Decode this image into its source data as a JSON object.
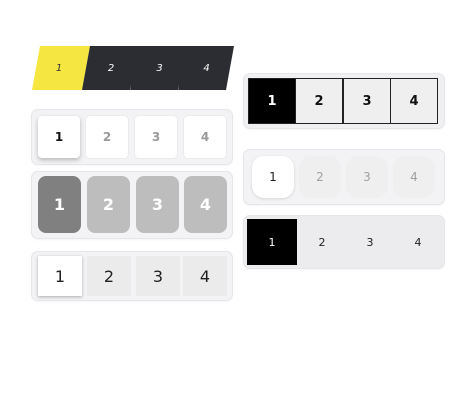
{
  "slanted_tabs": {
    "items": [
      "1",
      "2",
      "3",
      "4"
    ],
    "active_index": 0,
    "active_color": "#f5e642",
    "inactive_color": "#2c2c33"
  },
  "white_cards": {
    "items": [
      "1",
      "2",
      "3",
      "4"
    ],
    "active_index": 0
  },
  "grey_tiles": {
    "items": [
      "1",
      "2",
      "3",
      "4"
    ],
    "active_index": 0,
    "active_color": "#808080",
    "inactive_color": "#bdbdbd"
  },
  "light_boxes": {
    "items": [
      "1",
      "2",
      "3",
      "4"
    ],
    "active_index": 0
  },
  "bordered_segments": {
    "items": [
      "1",
      "2",
      "3",
      "4"
    ],
    "active_index": 0,
    "active_color": "#000000"
  },
  "rounded_soft": {
    "items": [
      "1",
      "2",
      "3",
      "4"
    ],
    "active_index": 0
  },
  "flat_segments": {
    "items": [
      "1",
      "2",
      "3",
      "4"
    ],
    "active_index": 0,
    "active_color": "#000000"
  }
}
